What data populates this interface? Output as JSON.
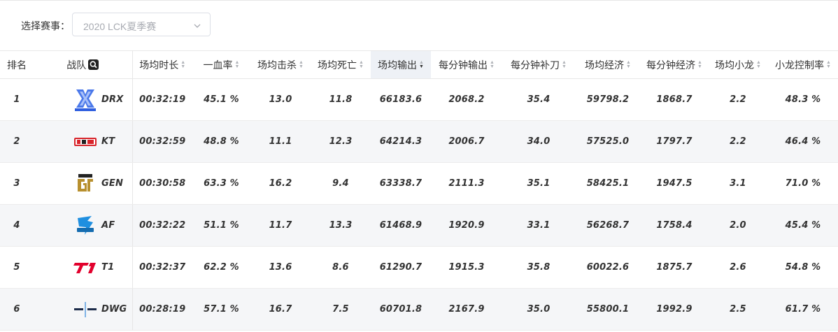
{
  "filter": {
    "label": "选择赛事：",
    "selected": "2020 LCK夏季赛"
  },
  "columns": {
    "rank": "排名",
    "team": "战队",
    "avg_time": "场均时长",
    "first_blood": "一血率",
    "avg_kills": "场均击杀",
    "avg_deaths": "场均死亡",
    "avg_damage": "场均输出",
    "dpm": "每分钟输出",
    "cspm": "每分钟补刀",
    "avg_gold": "场均经济",
    "gpm": "每分钟经济",
    "avg_dragons": "场均小龙",
    "dragon_control": "小龙控制率"
  },
  "sorted_column": "avg_damage",
  "sort_direction": "desc",
  "rows": [
    {
      "rank": "1",
      "team": "DRX",
      "logo": "drx-logo",
      "avg_time": "00:32:19",
      "first_blood": "45.1 %",
      "avg_kills": "13.0",
      "avg_deaths": "11.8",
      "avg_damage": "66183.6",
      "dpm": "2068.2",
      "cspm": "35.4",
      "avg_gold": "59798.2",
      "gpm": "1868.7",
      "avg_dragons": "2.2",
      "dragon_control": "48.3 %"
    },
    {
      "rank": "2",
      "team": "KT",
      "logo": "kt-logo",
      "avg_time": "00:32:59",
      "first_blood": "48.8 %",
      "avg_kills": "11.1",
      "avg_deaths": "12.3",
      "avg_damage": "64214.3",
      "dpm": "2006.7",
      "cspm": "34.0",
      "avg_gold": "57525.0",
      "gpm": "1797.7",
      "avg_dragons": "2.2",
      "dragon_control": "46.4 %"
    },
    {
      "rank": "3",
      "team": "GEN",
      "logo": "gen-logo",
      "avg_time": "00:30:58",
      "first_blood": "63.3 %",
      "avg_kills": "16.2",
      "avg_deaths": "9.4",
      "avg_damage": "63338.7",
      "dpm": "2111.3",
      "cspm": "35.1",
      "avg_gold": "58425.1",
      "gpm": "1947.5",
      "avg_dragons": "3.1",
      "dragon_control": "71.0 %"
    },
    {
      "rank": "4",
      "team": "AF",
      "logo": "af-logo",
      "avg_time": "00:32:22",
      "first_blood": "51.1 %",
      "avg_kills": "11.7",
      "avg_deaths": "13.3",
      "avg_damage": "61468.9",
      "dpm": "1920.9",
      "cspm": "33.1",
      "avg_gold": "56268.7",
      "gpm": "1758.4",
      "avg_dragons": "2.0",
      "dragon_control": "45.4 %"
    },
    {
      "rank": "5",
      "team": "T1",
      "logo": "t1-logo",
      "avg_time": "00:32:37",
      "first_blood": "62.2 %",
      "avg_kills": "13.6",
      "avg_deaths": "8.6",
      "avg_damage": "61290.7",
      "dpm": "1915.3",
      "cspm": "35.8",
      "avg_gold": "60022.6",
      "gpm": "1875.7",
      "avg_dragons": "2.6",
      "dragon_control": "54.8 %"
    },
    {
      "rank": "6",
      "team": "DWG",
      "logo": "dwg-logo",
      "avg_time": "00:28:19",
      "first_blood": "57.1 %",
      "avg_kills": "16.7",
      "avg_deaths": "7.5",
      "avg_damage": "60701.8",
      "dpm": "2167.9",
      "cspm": "35.0",
      "avg_gold": "55800.1",
      "gpm": "1992.9",
      "avg_dragons": "2.5",
      "dragon_control": "61.7 %"
    }
  ],
  "colors": {
    "drx": "#2f5fe0",
    "kt": "#d8232a",
    "gen": "#b8902f",
    "af": "#1f8fe0",
    "t1": "#e2012d",
    "dwg": "#1c2b4a",
    "sorted_header_bg": "#eef1f6",
    "row_alt_bg": "#f5f6f8"
  }
}
